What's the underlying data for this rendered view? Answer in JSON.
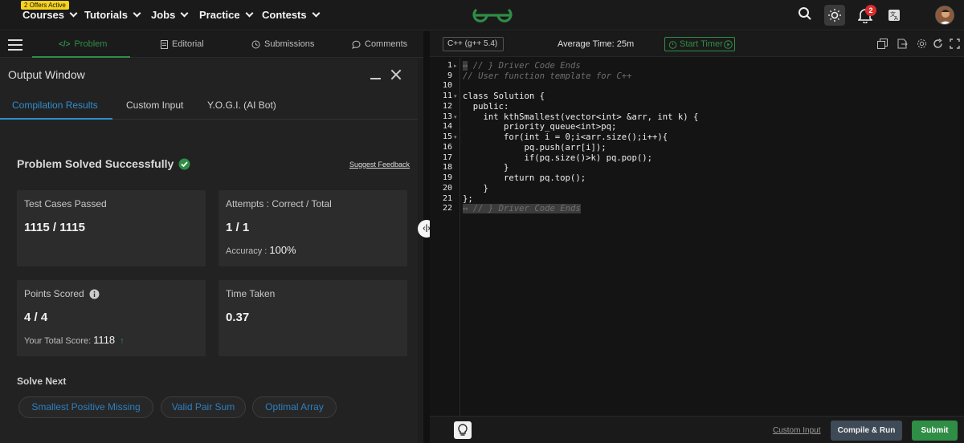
{
  "nav": {
    "offer_badge": "2 Offers Active",
    "items": [
      "Courses",
      "Tutorials",
      "Jobs",
      "Practice",
      "Contests"
    ],
    "notification_count": "2"
  },
  "problem_tabs": {
    "items": [
      "Problem",
      "Editorial",
      "Submissions",
      "Comments"
    ],
    "active": "Problem"
  },
  "output": {
    "title": "Output Window",
    "tabs": [
      "Compilation Results",
      "Custom Input",
      "Y.O.G.I. (AI Bot)"
    ],
    "status": "Problem Solved Successfully",
    "suggest_feedback": "Suggest Feedback",
    "cards": {
      "tests_label": "Test Cases Passed",
      "tests_value": "1115 / 1115",
      "attempts_label": "Attempts : Correct / Total",
      "attempts_value": "1 / 1",
      "accuracy_label": "Accuracy :",
      "accuracy_value": "100%",
      "points_label": "Points Scored",
      "points_value": "4 / 4",
      "total_label": "Your Total Score:",
      "total_value": "1118",
      "time_label": "Time Taken",
      "time_value": "0.37"
    },
    "solve_next_title": "Solve Next",
    "solve_next": [
      "Smallest Positive Missing",
      "Valid Pair Sum",
      "Optimal Array"
    ]
  },
  "editor": {
    "language": "C++ (g++ 5.4)",
    "average_time": "Average Time: 25m",
    "start_timer": "Start Timer",
    "line_numbers": [
      "1",
      "9",
      "10",
      "11",
      "12",
      "13",
      "14",
      "15",
      "16",
      "17",
      "18",
      "19",
      "20",
      "21",
      "22"
    ],
    "code_lines": [
      "// } Driver Code Ends",
      "// User function template for C++",
      "",
      "class Solution {",
      "  public:",
      "    int kthSmallest(vector<int> &arr, int k) {",
      "        priority_queue<int>pq;",
      "        for(int i = 0;i<arr.size();i++){",
      "            pq.push(arr[i]);",
      "            if(pq.size()>k) pq.pop();",
      "        }",
      "        return pq.top();",
      "    }",
      "};",
      "// } Driver Code Ends"
    ],
    "custom_input": "Custom Input",
    "compile_run": "Compile & Run",
    "submit": "Submit"
  },
  "colors": {
    "accent_green": "#2f8d46",
    "link_blue": "#2f8fd0"
  }
}
